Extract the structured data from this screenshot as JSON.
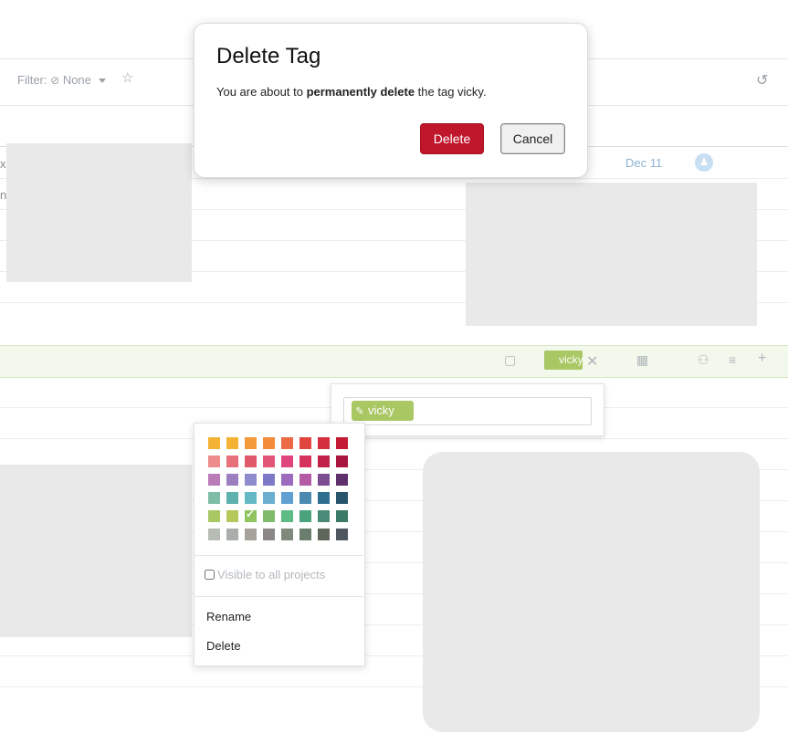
{
  "toolbar": {
    "filter_label": "Filter:",
    "filter_value": "None",
    "star_icon": "star-icon",
    "undo_icon": "undo-icon"
  },
  "task_row": {
    "date": "Dec 11",
    "avatar_icon": "user-icon"
  },
  "selected_row": {
    "tag_text": "vicky",
    "icons": [
      "subtask-icon",
      "calendar-icon",
      "assignee-icon",
      "list-icon",
      "add-icon"
    ]
  },
  "tag_editor": {
    "tag_label": "vicky",
    "edit_icon": "pencil-icon"
  },
  "color_menu": {
    "colors": [
      [
        "#f5b335",
        "#f5b335",
        "#f59a3b",
        "#f28b3a",
        "#ec6b44",
        "#e0463d",
        "#d32f3f",
        "#c41a35"
      ],
      [
        "#ee8b8b",
        "#e8707a",
        "#e0596a",
        "#e25478",
        "#e0457e",
        "#d5335e",
        "#c1224a",
        "#a8163f"
      ],
      [
        "#b97cb8",
        "#9b7fc0",
        "#8e8ccc",
        "#7d79c7",
        "#9c6bbe",
        "#b55aa4",
        "#7d4d91",
        "#5f2f6b"
      ],
      [
        "#7fbea6",
        "#5fb1ad",
        "#64b9c5",
        "#6aaed0",
        "#5f9fd1",
        "#4c89b0",
        "#2e6e91",
        "#26546b"
      ],
      [
        "#a9c763",
        "#b5c85a",
        "#8fc45e",
        "#7fbb6a",
        "#5dbb83",
        "#4aa37d",
        "#4a8b78",
        "#3a7a66"
      ],
      [
        "#b7bcb5",
        "#a9aeaa",
        "#a8a29c",
        "#8b8787",
        "#7f8a7d",
        "#6b7e6d",
        "#5d6659",
        "#4f575e"
      ]
    ],
    "selected": {
      "row": 4,
      "col": 2
    },
    "visible_label": "Visible to all projects",
    "rename_label": "Rename",
    "delete_label": "Delete"
  },
  "modal": {
    "title": "Delete Tag",
    "message_before": "You are about to ",
    "message_bold": "permanently delete",
    "message_after": " the tag vicky.",
    "delete_button": "Delete",
    "cancel_button": "Cancel"
  },
  "stubs": {
    "left_top": "x",
    "left_second": "n"
  }
}
